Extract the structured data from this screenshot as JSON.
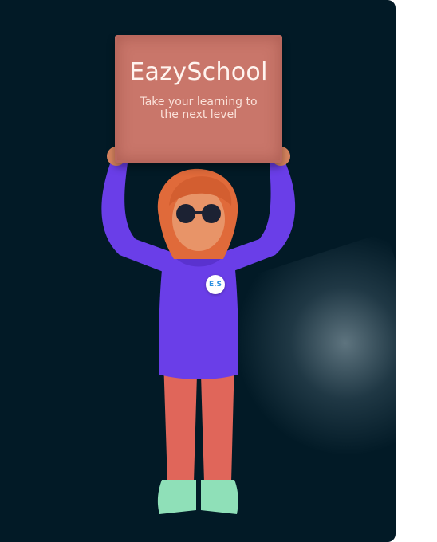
{
  "sign": {
    "title": "EazySchool",
    "subtitle": "Take your learning to the next level"
  },
  "badge": {
    "label": "E.S"
  },
  "colors": {
    "background": "#021a26",
    "sign": "#c9766a",
    "hoodie": "#6a3ee8",
    "pants": "#e0665a",
    "shoes": "#8fe0b8",
    "hair": "#e06a3a",
    "badge_text": "#2b8fe0"
  }
}
